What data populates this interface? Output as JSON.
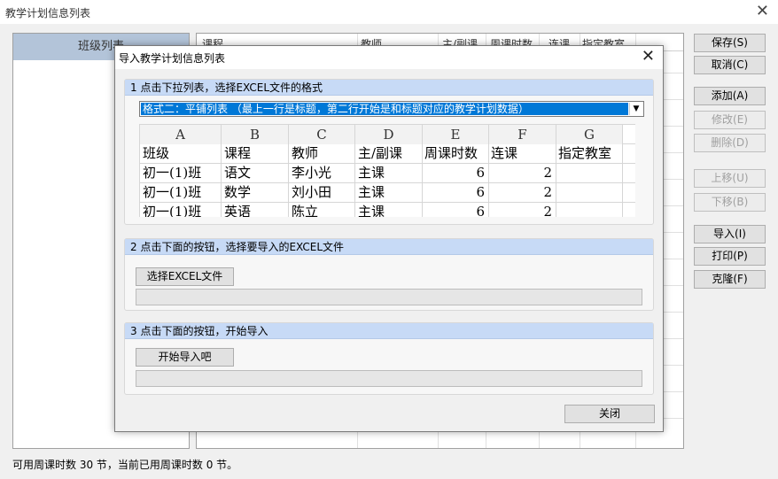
{
  "window": {
    "title": "教学计划信息列表"
  },
  "class_panel": {
    "header": "班级列表"
  },
  "plan_grid": {
    "columns": [
      "课程",
      "教师",
      "主/副课",
      "周课时数",
      "连课",
      "指定教室"
    ]
  },
  "side_buttons": [
    {
      "label": "保存(S)",
      "enabled": true
    },
    {
      "label": "取消(C)",
      "enabled": true
    },
    {
      "label": "添加(A)",
      "enabled": true
    },
    {
      "label": "修改(E)",
      "enabled": false
    },
    {
      "label": "删除(D)",
      "enabled": false
    },
    {
      "label": "上移(U)",
      "enabled": false
    },
    {
      "label": "下移(B)",
      "enabled": false
    },
    {
      "label": "导入(I)",
      "enabled": true
    },
    {
      "label": "打印(P)",
      "enabled": true
    },
    {
      "label": "克隆(F)",
      "enabled": true
    }
  ],
  "status": "可用周课时数 30 节，当前已用周课时数 0 节。",
  "dialog": {
    "title": "导入教学计划信息列表",
    "step1": {
      "heading": "1 点击下拉列表，选择EXCEL文件的格式",
      "selected_format": "格式二：平铺列表 （最上一行是标题，第二行开始是和标题对应的教学计划数据）",
      "sheet": {
        "col_letters": [
          "A",
          "B",
          "C",
          "D",
          "E",
          "F",
          "G"
        ],
        "header": [
          "班级",
          "课程",
          "教师",
          "主/副课",
          "周课时数",
          "连课",
          "指定教室"
        ],
        "rows": [
          [
            "初一(1)班",
            "语文",
            "李小光",
            "主课",
            "6",
            "2",
            ""
          ],
          [
            "初一(1)班",
            "数学",
            "刘小田",
            "主课",
            "6",
            "2",
            ""
          ],
          [
            "初一(1)班",
            "英语",
            "陈立",
            "主课",
            "6",
            "2",
            ""
          ]
        ]
      }
    },
    "step2": {
      "heading": "2 点击下面的按钮，选择要导入的EXCEL文件",
      "button": "选择EXCEL文件"
    },
    "step3": {
      "heading": "3 点击下面的按钮，开始导入",
      "button": "开始导入吧"
    },
    "close_button": "关闭"
  }
}
